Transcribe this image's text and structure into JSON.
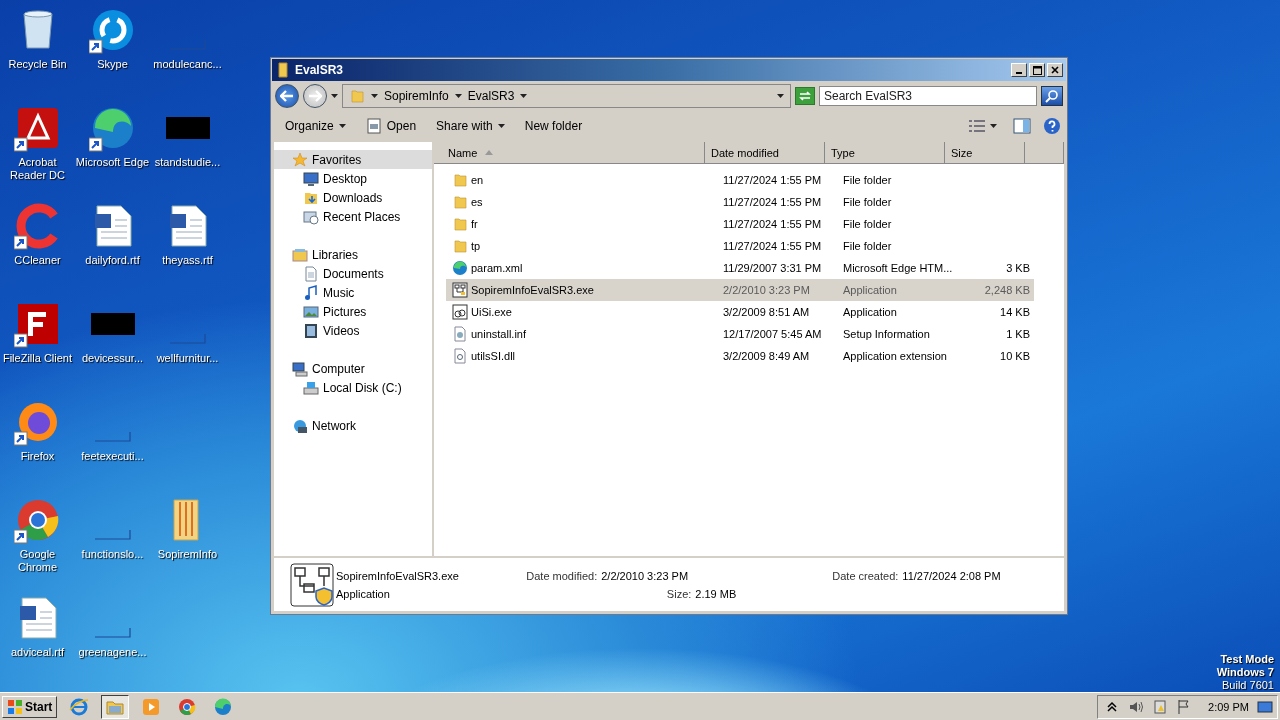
{
  "desktop_icon_rows": [
    [
      {
        "label": "Recycle Bin",
        "kind": "recycle",
        "shortcut": false
      },
      {
        "label": "Skype",
        "kind": "skype",
        "shortcut": true
      },
      {
        "label": "modulecanc...",
        "kind": "blank"
      }
    ],
    [
      {
        "label": "Acrobat Reader DC",
        "kind": "acrobat",
        "shortcut": true
      },
      {
        "label": "Microsoft Edge",
        "kind": "edge",
        "shortcut": true
      },
      {
        "label": "standstudie...",
        "kind": "black"
      }
    ],
    [
      {
        "label": "CCleaner",
        "kind": "ccleaner",
        "shortcut": true
      },
      {
        "label": "dailyford.rtf",
        "kind": "word",
        "shortcut": false
      },
      {
        "label": "theyass.rtf",
        "kind": "word",
        "shortcut": false
      }
    ],
    [
      {
        "label": "FileZilla Client",
        "kind": "filezilla",
        "shortcut": true
      },
      {
        "label": "devicessur...",
        "kind": "black"
      },
      {
        "label": "wellfurnitur...",
        "kind": "blank"
      }
    ],
    [
      {
        "label": "Firefox",
        "kind": "firefox",
        "shortcut": true
      },
      {
        "label": "feetexecuti...",
        "kind": "blank"
      }
    ],
    [
      {
        "label": "Google Chrome",
        "kind": "chrome",
        "shortcut": true
      },
      {
        "label": "functionslo...",
        "kind": "blank"
      },
      {
        "label": "SopiremInfo",
        "kind": "folder",
        "shortcut": false
      }
    ],
    [
      {
        "label": "adviceal.rtf",
        "kind": "word",
        "shortcut": false
      },
      {
        "label": "greenagene...",
        "kind": "blank"
      }
    ]
  ],
  "window": {
    "title": "EvalSR3",
    "breadcrumb": [
      "SopiremInfo",
      "EvalSR3"
    ],
    "search": {
      "placeholder": "Search EvalSR3"
    },
    "toolbar": [
      {
        "label": "Organize",
        "kind": "menu"
      },
      {
        "label": "Open",
        "kind": "open"
      },
      {
        "label": "Share with",
        "kind": "menu"
      },
      {
        "label": "New folder",
        "kind": "plain"
      }
    ],
    "nav": [
      {
        "label": "Favorites",
        "kind": "star",
        "selected": true,
        "children": [
          {
            "label": "Desktop",
            "kind": "desktop",
            "selected": false
          },
          {
            "label": "Downloads",
            "kind": "downloads",
            "selected": false
          },
          {
            "label": "Recent Places",
            "kind": "recent",
            "selected": false
          }
        ]
      },
      {
        "label": "Libraries",
        "kind": "libraries",
        "selected": false,
        "children": [
          {
            "label": "Documents",
            "kind": "documents",
            "selected": false
          },
          {
            "label": "Music",
            "kind": "music",
            "selected": false
          },
          {
            "label": "Pictures",
            "kind": "pictures",
            "selected": false
          },
          {
            "label": "Videos",
            "kind": "videos",
            "selected": false
          }
        ]
      },
      {
        "label": "Computer",
        "kind": "computer",
        "selected": false,
        "children": [
          {
            "label": "Local Disk (C:)",
            "kind": "disk",
            "selected": false
          }
        ]
      },
      {
        "label": "Network",
        "kind": "network",
        "selected": false
      }
    ],
    "columns": [
      "Name",
      "Date modified",
      "Type",
      "Size"
    ],
    "rows": [
      {
        "name": "en",
        "kind": "folder",
        "date": "11/27/2024 1:55 PM",
        "type": "File folder",
        "size": "",
        "selected": false
      },
      {
        "name": "es",
        "kind": "folder",
        "date": "11/27/2024 1:55 PM",
        "type": "File folder",
        "size": "",
        "selected": false
      },
      {
        "name": "fr",
        "kind": "folder",
        "date": "11/27/2024 1:55 PM",
        "type": "File folder",
        "size": "",
        "selected": false
      },
      {
        "name": "tp",
        "kind": "folder",
        "date": "11/27/2024 1:55 PM",
        "type": "File folder",
        "size": "",
        "selected": false
      },
      {
        "name": "param.xml",
        "kind": "edge",
        "date": "11/29/2007 3:31 PM",
        "type": "Microsoft Edge HTM...",
        "size": "3 KB",
        "selected": false
      },
      {
        "name": "SopiremInfoEvalSR3.exe",
        "kind": "network-app",
        "date": "2/2/2010 3:23 PM",
        "type": "Application",
        "size": "2,248 KB",
        "selected": true
      },
      {
        "name": "UiSi.exe",
        "kind": "app",
        "date": "3/2/2009 8:51 AM",
        "type": "Application",
        "size": "14 KB",
        "selected": false
      },
      {
        "name": "uninstall.inf",
        "kind": "settings",
        "date": "12/17/2007 5:45 AM",
        "type": "Setup Information",
        "size": "1 KB",
        "selected": false
      },
      {
        "name": "utilsSI.dll",
        "kind": "dll",
        "date": "3/2/2009 8:49 AM",
        "type": "Application extension",
        "size": "10 KB",
        "selected": false
      }
    ],
    "details": {
      "name": "SopiremInfoEvalSR3.exe",
      "type": "Application",
      "modified_label": "Date modified:",
      "modified": "2/2/2010 3:23 PM",
      "created_label": "Date created:",
      "created": "11/27/2024 2:08 PM",
      "size_label": "Size:",
      "size": "2.19 MB"
    }
  },
  "test_mode": [
    "Test Mode",
    "Windows 7",
    "Build 7601"
  ],
  "taskbar": {
    "start": "Start",
    "apps": [
      {
        "kind": "ie",
        "selected": false
      },
      {
        "kind": "explorer",
        "selected": true
      },
      {
        "kind": "media",
        "selected": false
      },
      {
        "kind": "chrome",
        "selected": false
      },
      {
        "kind": "edge",
        "selected": false
      }
    ],
    "clock": "2:09 PM"
  }
}
